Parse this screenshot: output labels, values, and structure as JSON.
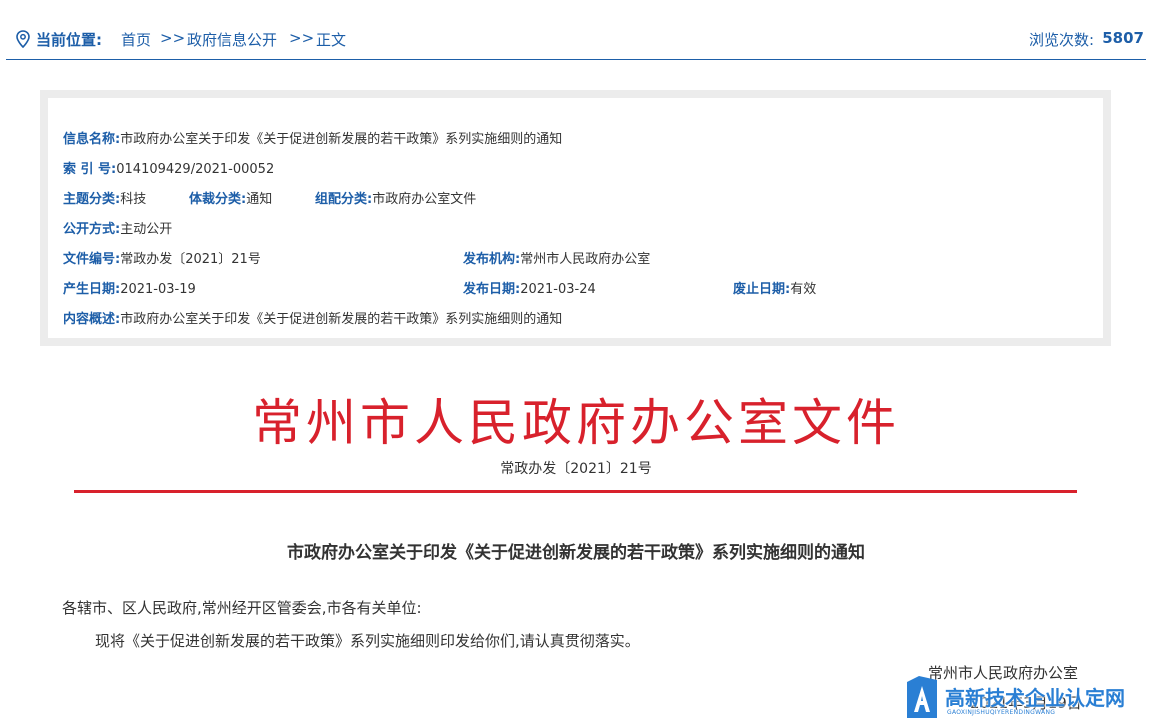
{
  "breadcrumb": {
    "label": "当前位置:",
    "home": "首页",
    "sep1": ">>",
    "section": "政府信息公开",
    "sep2": ">>",
    "current": "正文"
  },
  "views": {
    "label": "浏览次数:",
    "count": "5807"
  },
  "meta": {
    "name_label": "信息名称:",
    "name_value": "市政府办公室关于印发《关于促进创新发展的若干政策》系列实施细则的通知",
    "index_label": "索 引 号:",
    "index_value": "014109429/2021-00052",
    "topic_label": "主题分类:",
    "topic_value": "科技",
    "genre_label": "体裁分类:",
    "genre_value": "通知",
    "org_cat_label": "组配分类:",
    "org_cat_value": "市政府办公室文件",
    "open_label": "公开方式:",
    "open_value": "主动公开",
    "docno_label": "文件编号:",
    "docno_value": "常政办发〔2021〕21号",
    "issuer_label": "发布机构:",
    "issuer_value": "常州市人民政府办公室",
    "created_label": "产生日期:",
    "created_value": "2021-03-19",
    "published_label": "发布日期:",
    "published_value": "2021-03-24",
    "expiry_label": "废止日期:",
    "expiry_value": "有效",
    "summary_label": "内容概述:",
    "summary_value": "市政府办公室关于印发《关于促进创新发展的若干政策》系列实施细则的通知"
  },
  "document": {
    "header": "常州市人民政府办公室文件",
    "number": "常政办发〔2021〕21号",
    "title": "市政府办公室关于印发《关于促进创新发展的若干政策》系列实施细则的通知",
    "salutation": "各辖市、区人民政府,常州经开区管委会,市各有关单位:",
    "body": "现将《关于促进创新发展的若干政策》系列实施细则印发给你们,请认真贯彻落实。",
    "signer": "常州市人民政府办公室",
    "date": "2021年3月19日"
  },
  "watermark": {
    "text": "高新技术企业认定网",
    "sub": "GAOXINJISHUQIYERENDINGWANG"
  },
  "colors": {
    "accent": "#1d5ea8",
    "red": "#d8212c",
    "watermark": "#2a7fd4"
  }
}
